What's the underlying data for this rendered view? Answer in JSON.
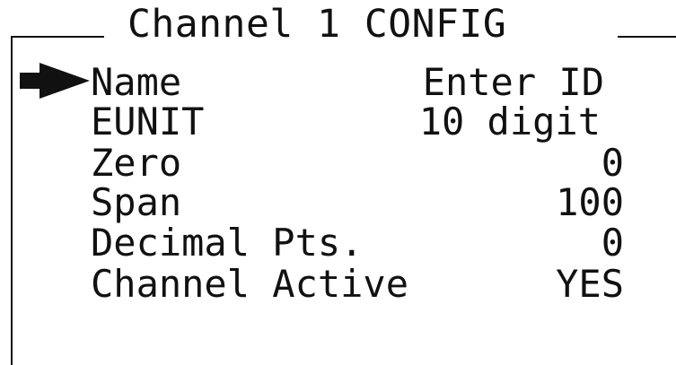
{
  "screen": {
    "title": "Channel 1 CONFIG"
  },
  "menu": {
    "items": [
      {
        "label": "Name",
        "value": "Enter ID"
      },
      {
        "label": "EUNIT",
        "value": "10 digit"
      },
      {
        "label": "Zero",
        "value": "0"
      },
      {
        "label": "Span",
        "value": "100"
      },
      {
        "label": "Decimal Pts.",
        "value": "0"
      },
      {
        "label": "Channel Active",
        "value": "YES"
      }
    ],
    "selected_index": 0
  },
  "icons": {
    "cursor": "selection-arrow-icon"
  }
}
